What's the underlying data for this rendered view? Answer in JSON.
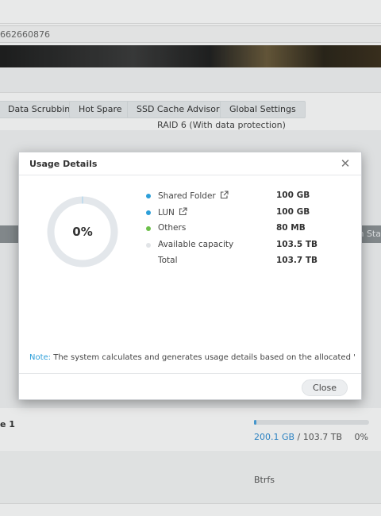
{
  "page": {
    "url_fragment": "662660876",
    "tabs": [
      {
        "label": "Data Scrubbing"
      },
      {
        "label": "Hot Spare"
      },
      {
        "label": "SSD Cache Advisor"
      },
      {
        "label": "Global Settings"
      }
    ],
    "raid_type": "RAID 6 (With data protection)",
    "table_header_fragment": "n Sta",
    "volume": {
      "name_fragment": "e 1",
      "used": "200.1 GB",
      "separator": " / ",
      "total": "103.7 TB",
      "percent": "0%",
      "usage_fraction": 0.02
    },
    "filesystem": "Btrfs"
  },
  "dialog": {
    "title": "Usage Details",
    "close_icon": "close-icon",
    "donut_percent": "0%",
    "legend": [
      {
        "label": "Shared Folder",
        "value": "100 GB",
        "color": "#2d9fd9",
        "external_link": true
      },
      {
        "label": "LUN",
        "value": "100 GB",
        "color": "#2d9fd9",
        "external_link": true
      },
      {
        "label": "Others",
        "value": "80 MB",
        "color": "#6cc04a",
        "external_link": false
      },
      {
        "label": "Available capacity",
        "value": "103.5 TB",
        "color": "#e1e4e7",
        "external_link": false
      },
      {
        "label": "Total",
        "value": "103.7 TB",
        "color": "",
        "external_link": false
      }
    ],
    "note_label": "Note:",
    "note_text": " The system calculates and generates usage details based on the allocated \"si...",
    "close_button_label": "Close"
  }
}
